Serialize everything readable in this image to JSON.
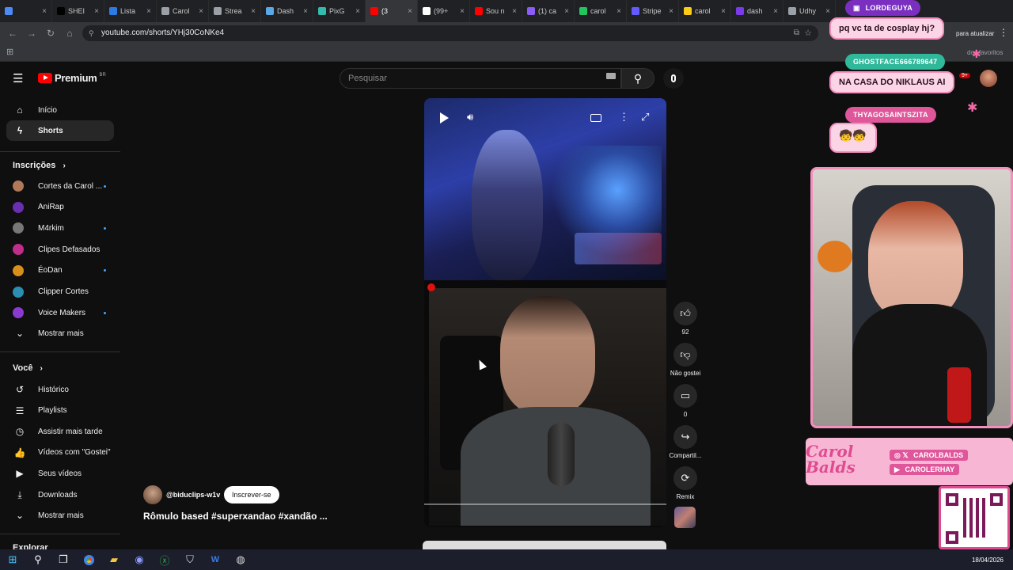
{
  "browser": {
    "tabs": [
      {
        "label": "",
        "color": "#4c8bf5"
      },
      {
        "label": "SHEI",
        "color": "#000000"
      },
      {
        "label": "Lista",
        "color": "#2c7be5"
      },
      {
        "label": "Carol",
        "color": "#9aa0a6"
      },
      {
        "label": "Strea",
        "color": "#9aa0a6"
      },
      {
        "label": "Dash",
        "color": "#5aa9e6"
      },
      {
        "label": "PixG",
        "color": "#32bcad"
      },
      {
        "label": "(3",
        "color": "#ff0000"
      },
      {
        "label": "(99+",
        "color": "#ffffff"
      },
      {
        "label": "Sou n",
        "color": "#ff0000"
      },
      {
        "label": "(1) ca",
        "color": "#8b5cf6"
      },
      {
        "label": "carol",
        "color": "#22c55e"
      },
      {
        "label": "Stripe",
        "color": "#635bff"
      },
      {
        "label": "carol",
        "color": "#facc15"
      },
      {
        "label": "dash",
        "color": "#7c3aed"
      },
      {
        "label": "Udhy",
        "color": "#9aa0a6"
      }
    ],
    "url": "youtube.com/shorts/YHj30CoNKe4",
    "update_label": "para atualizar",
    "favorites_label": "dos favoritos"
  },
  "youtube": {
    "logo_text": "Premium",
    "logo_region": "BR",
    "search_placeholder": "Pesquisar",
    "sidebar": {
      "home": "Início",
      "shorts": "Shorts",
      "subs_header": "Inscrições",
      "subscriptions": [
        {
          "label": "Cortes da Carol ...",
          "color": "#b07a5a",
          "dot": true
        },
        {
          "label": "AniRap",
          "color": "#6a2fb0",
          "dot": false
        },
        {
          "label": "M4rkim",
          "color": "#777777",
          "dot": true
        },
        {
          "label": "Clipes Defasados",
          "color": "#c02d8a",
          "dot": false
        },
        {
          "label": "ÉoDan",
          "color": "#d9901a",
          "dot": true
        },
        {
          "label": "Clipper Cortes",
          "color": "#2a8fb0",
          "dot": false
        },
        {
          "label": "Voice Makers",
          "color": "#8a3ad0",
          "dot": true
        }
      ],
      "show_more_1": "Mostrar mais",
      "you_header": "Você",
      "you_items": [
        {
          "label": "Histórico",
          "icon": "history-icon",
          "glyph": "↺"
        },
        {
          "label": "Playlists",
          "icon": "playlists-icon",
          "glyph": "☰"
        },
        {
          "label": "Assistir mais tarde",
          "icon": "watch-later-icon",
          "glyph": "◷"
        },
        {
          "label": "Vídeos com \"Gostei\"",
          "icon": "like-icon",
          "glyph": "👍"
        },
        {
          "label": "Seus vídeos",
          "icon": "your-videos-icon",
          "glyph": "▶"
        },
        {
          "label": "Downloads",
          "icon": "download-icon",
          "glyph": "⤓"
        }
      ],
      "show_more_2": "Mostrar mais",
      "explore_header": "Explorar"
    },
    "short": {
      "channel": "@biduclips-w1v",
      "subscribe_label": "Inscrever-se",
      "title": "Rômulo based #superxandao #xandão ..."
    },
    "actions": {
      "likes": "92",
      "dislike_label": "Não gostei",
      "comments": "0",
      "share_label": "Compartil...",
      "remix_label": "Remix"
    }
  },
  "stream": {
    "chat": [
      {
        "name": "LORDEGUYA",
        "message": "pq vc ta de cosplay hj?",
        "name_color": "#7a2fc0"
      },
      {
        "name": "GHOSTFACE666789647",
        "message": "NA CASA DO NIKLAUS AI",
        "name_color": "#2fb89a"
      },
      {
        "name": "THYAGOSAINTSZITA",
        "message": "",
        "name_color": "#e0569a"
      }
    ],
    "brand_logo": "Carol Balds",
    "socials": [
      "CAROLBALDS",
      "CAROLERHAY"
    ],
    "notification_count": "9+"
  },
  "taskbar": {
    "date": "18/04/2026"
  }
}
